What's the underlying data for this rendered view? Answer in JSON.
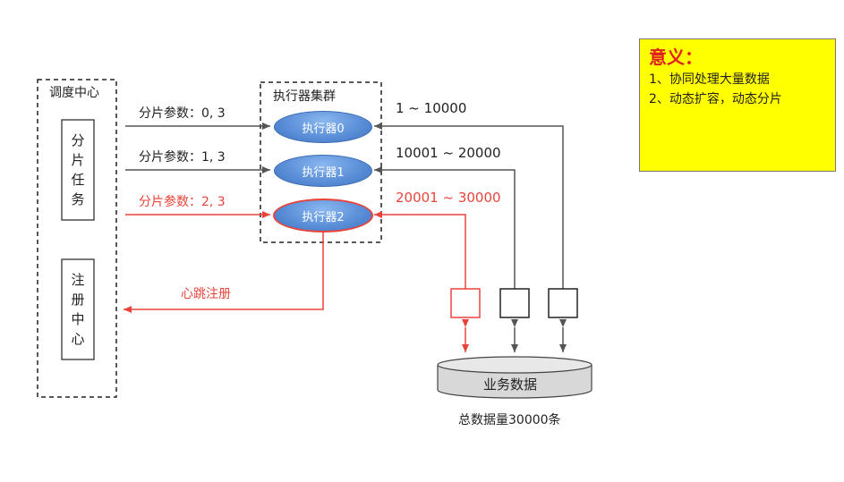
{
  "scheduler": {
    "title": "调度中心",
    "shard_task_chars": [
      "分",
      "片",
      "任",
      "务"
    ],
    "register_chars": [
      "注",
      "册",
      "中",
      "心"
    ]
  },
  "cluster": {
    "title": "执行器集群",
    "executors": [
      "执行器0",
      "执行器1",
      "执行器2"
    ]
  },
  "params": [
    "分片参数：0, 3",
    "分片参数：1, 3",
    "分片参数：2, 3"
  ],
  "ranges": [
    "1 ~ 10000",
    "10001 ~ 20000",
    "20001 ~ 30000"
  ],
  "heartbeat_label": "心跳注册",
  "database": {
    "label": "业务数据",
    "total": "总数据量30000条"
  },
  "meaning": {
    "title": "意义：",
    "items": [
      "1、协同处理大量数据",
      "2、动态扩容，动态分片"
    ]
  },
  "colors": {
    "highlight": "#e8443a",
    "arrow": "#555555",
    "note_bg": "#ffff00"
  }
}
